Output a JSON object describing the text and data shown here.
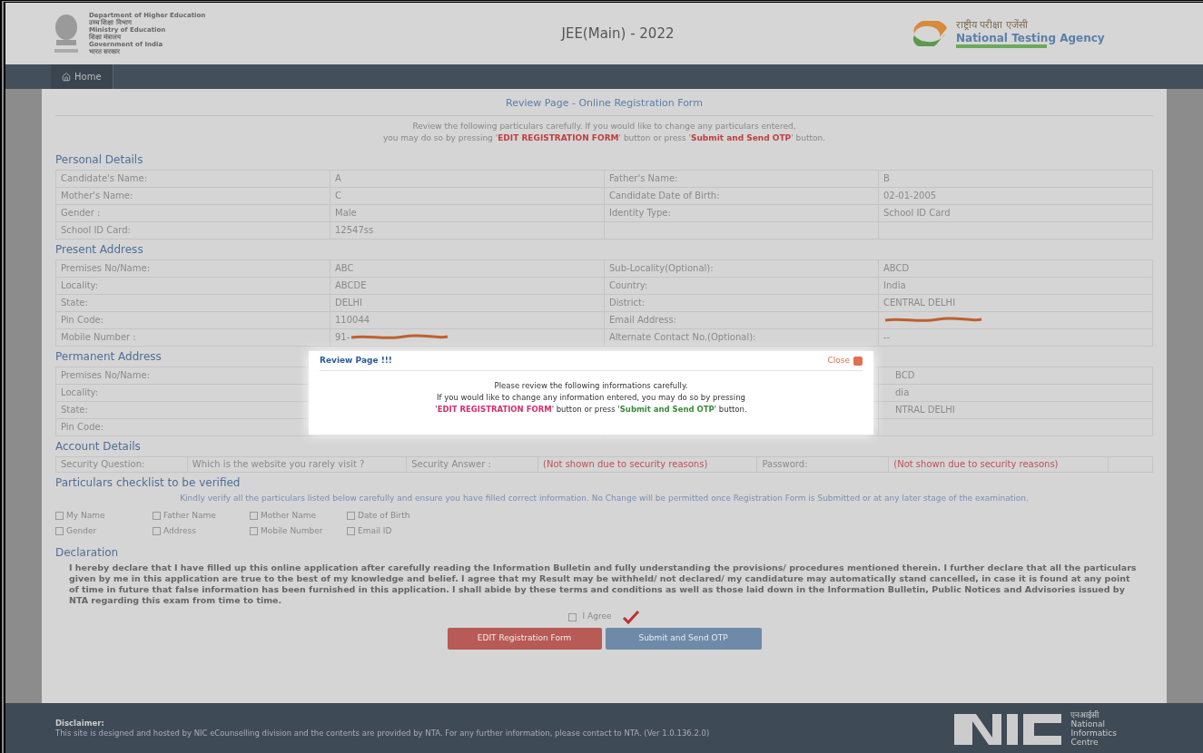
{
  "header": {
    "department_lines": [
      "Department of Higher Education",
      "उच्च शिक्षा विभाग",
      "Ministry of Education",
      "शिक्षा मंत्रालय",
      "Government of India",
      "भारत सरकार"
    ],
    "exam_title": "JEE(Main) - 2022",
    "agency_hindi": "राष्ट्रीय परीक्षा एजेंसी",
    "agency_name": "National Testing Agency"
  },
  "nav": {
    "items": [
      {
        "label": "Home",
        "selected": true
      }
    ]
  },
  "page_title": "Review Page - Online Registration Form",
  "intro": [
    "Review the following particulars carefully. If you would like to change any particulars entered,",
    "you may do so by pressing '**EDIT REGISTRATION FORM**' button or press '**Submit and Send OTP**' button."
  ],
  "sections": [
    {
      "title": "Personal Details",
      "rows": [
        [
          "Candidate's Name:",
          "A",
          "Father's Name:",
          "B"
        ],
        [
          "Mother's Name:",
          "C",
          "Candidate Date of Birth:",
          "02-01-2005"
        ],
        [
          "Gender :",
          "Male",
          "Identity Type:",
          "School ID Card"
        ],
        [
          "School ID Card:",
          "12547ss",
          "",
          ""
        ]
      ]
    },
    {
      "title": "Present Address",
      "rows": [
        [
          "Premises No/Name:",
          "ABC",
          "Sub-Locality(Optional):",
          "ABCD"
        ],
        [
          "Locality:",
          "ABCDE",
          "Country:",
          "India"
        ],
        [
          "State:",
          "DELHI",
          "District:",
          "CENTRAL DELHI"
        ],
        [
          "Pin Code:",
          "110044",
          "Email Address:",
          {
            "redacted": true
          }
        ],
        [
          "Mobile Number :",
          {
            "text": "91-",
            "redacted": true
          },
          "Alternate Contact No.(Optional):",
          "--"
        ]
      ]
    },
    {
      "title": "Permanent Address",
      "rows": [
        [
          "Premises No/Name:",
          "",
          "",
          "BCD"
        ],
        [
          "Locality:",
          "",
          "",
          "dia"
        ],
        [
          "State:",
          "",
          "",
          "NTRAL DELHI"
        ],
        [
          "Pin Code:",
          "",
          "",
          ""
        ]
      ]
    }
  ],
  "account": {
    "title": "Account Details",
    "cells": [
      {
        "text": "Security Question:",
        "kind": "label"
      },
      {
        "text": "Which is the website you rarely visit ?",
        "kind": "value"
      },
      {
        "text": "Security Answer :",
        "kind": "label"
      },
      {
        "text": "(Not shown due to security reasons)",
        "kind": "warning"
      },
      {
        "text": "Password:",
        "kind": "label"
      },
      {
        "text": "(Not shown due to security reasons)",
        "kind": "warning"
      }
    ]
  },
  "checklist": {
    "title": "Particulars checklist to be verified",
    "note": "Kindly verify all the particulars listed below carefully and ensure you have filled correct information. No Change will be permitted once Registration Form is Submitted or at any later stage of the examination.",
    "items": [
      [
        {
          "label": "My Name",
          "checked": false
        },
        {
          "label": "Father Name",
          "checked": false
        },
        {
          "label": "Mother Name",
          "checked": false
        },
        {
          "label": "Date of Birth",
          "checked": false
        }
      ],
      [
        {
          "label": "Gender",
          "checked": false
        },
        {
          "label": "Address",
          "checked": false
        },
        {
          "label": "Mobile Number",
          "checked": false
        },
        {
          "label": "Email ID",
          "checked": false
        }
      ]
    ]
  },
  "declaration": {
    "title": "Declaration",
    "text": "I hereby declare that I have filled up this online application after carefully reading the Information Bulletin and fully understanding the provisions/ procedures mentioned therein. I further declare that all the particulars given by me in this application are true to the best of my knowledge and belief. I agree that my Result may be withheld/ not declared/ my candidature may automatically stand cancelled, in case it is found at any point of time in future that false information has been furnished in this application. I shall abide by these terms and conditions as well as those laid down in the Information Bulletin, Public Notices and Advisories issued by NTA regarding this exam from time to time.",
    "agree": {
      "label": "I Agree",
      "checked": false
    }
  },
  "buttons": [
    {
      "label": "EDIT Registration Form",
      "kind": "danger"
    },
    {
      "label": "Submit and Send OTP",
      "kind": "primary"
    }
  ],
  "footer": {
    "title": "Disclaimer:",
    "text": "This site is designed and hosted by NIC eCounselling division and the contents are provided by NTA. For any further information, please contact to NTA. (Ver 1.0.136.2.0)",
    "nic_hindi": "एनआईसी",
    "nic_lines": [
      "National",
      "Informatics",
      "Centre"
    ]
  },
  "modal": {
    "title": "Review Page !!!",
    "close": "Close",
    "lines": [
      "Please review the following informations carefully.",
      "If you would like to change any information entered, you may do so by pressing",
      "'**EDIT REGISTRATION FORM**' button or press '**Submit and Send OTP**' button."
    ]
  }
}
